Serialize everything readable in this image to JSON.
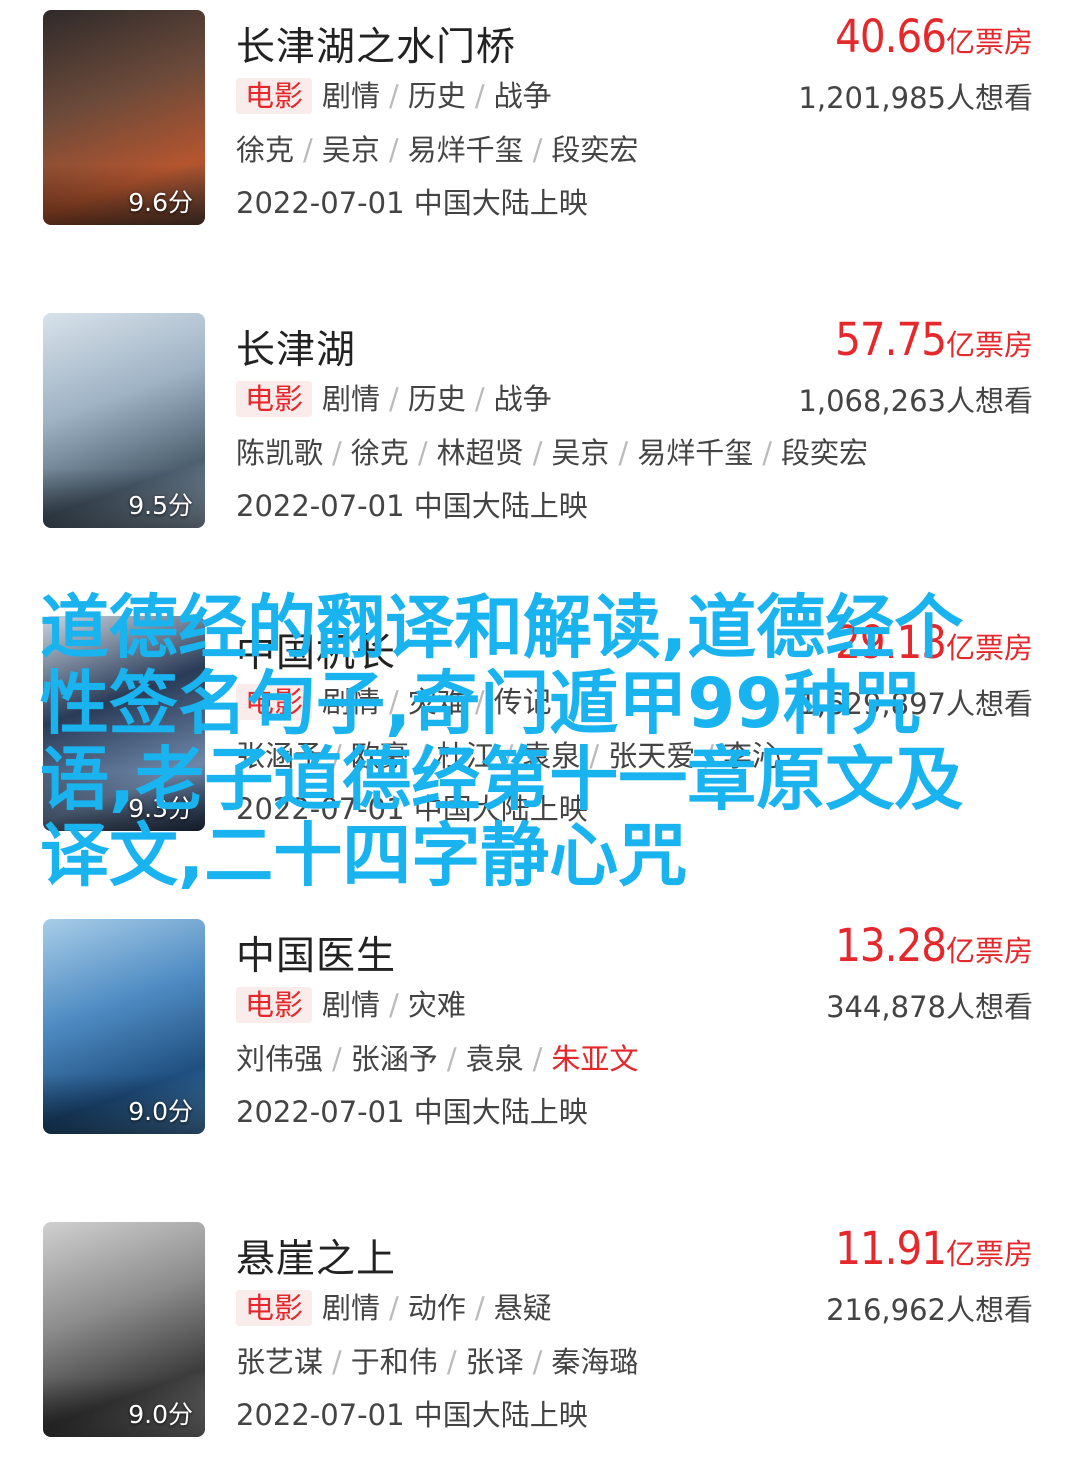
{
  "movies": [
    {
      "title": "长津湖之水门桥",
      "box_office": "40.66",
      "box_unit": "亿票房",
      "tag": "电影",
      "genres": [
        "剧情",
        "历史",
        "战争"
      ],
      "want": "1,201,985人想看",
      "cast": [
        "徐克",
        "吴京",
        "易烊千玺",
        "段奕宏"
      ],
      "release": "2022-07-01 中国大陆上映",
      "score": "9.6分",
      "poster_colors": [
        "#6b4a3a",
        "#b4552f",
        "#2f2a2a"
      ]
    },
    {
      "title": "长津湖",
      "box_office": "57.75",
      "box_unit": "亿票房",
      "tag": "电影",
      "genres": [
        "剧情",
        "历史",
        "战争"
      ],
      "want": "1,068,263人想看",
      "cast": [
        "陈凯歌",
        "徐克",
        "林超贤",
        "吴京",
        "易烊千玺",
        "段奕宏"
      ],
      "release": "2022-07-01 中国大陆上映",
      "score": "9.5分",
      "poster_colors": [
        "#9fb3c5",
        "#4d6070",
        "#d8e2ea"
      ]
    },
    {
      "title": "中国机长",
      "box_office": "29.13",
      "box_unit": "亿票房",
      "tag": "电影",
      "genres": [
        "剧情",
        "灾难",
        "传记"
      ],
      "want": "1,629,897人想看",
      "cast": [
        "张涵予",
        "欧豪",
        "杜江",
        "袁泉",
        "张天爱",
        "李沁"
      ],
      "release": "2022-07-01 中国大陆上映",
      "score": "9.3分",
      "poster_colors": [
        "#2a3b57",
        "#6e87a8",
        "#c8d4e0"
      ]
    },
    {
      "title": "中国医生",
      "box_office": "13.28",
      "box_unit": "亿票房",
      "tag": "电影",
      "genres": [
        "剧情",
        "灾难"
      ],
      "want": "344,878人想看",
      "cast": [
        "刘伟强",
        "张涵予",
        "袁泉",
        "朱亚文"
      ],
      "cast_highlight": 3,
      "release": "2022-07-01 中国大陆上映",
      "score": "9.0分",
      "poster_colors": [
        "#4f8cc3",
        "#1f4f80",
        "#a8cde8"
      ]
    },
    {
      "title": "悬崖之上",
      "box_office": "11.91",
      "box_unit": "亿票房",
      "tag": "电影",
      "genres": [
        "剧情",
        "动作",
        "悬疑"
      ],
      "want": "216,962人想看",
      "cast": [
        "张艺谋",
        "于和伟",
        "张译",
        "秦海璐"
      ],
      "release": "2022-07-01 中国大陆上映",
      "score": "9.0分",
      "poster_colors": [
        "#8d8d8d",
        "#3c3c3c",
        "#d0d0d0"
      ]
    }
  ],
  "overlay_text": "道德经的翻译和解读,道德经个性签名句子,奇门遁甲99种咒语,老子道德经第十一章原文及译文,二十四字静心咒"
}
